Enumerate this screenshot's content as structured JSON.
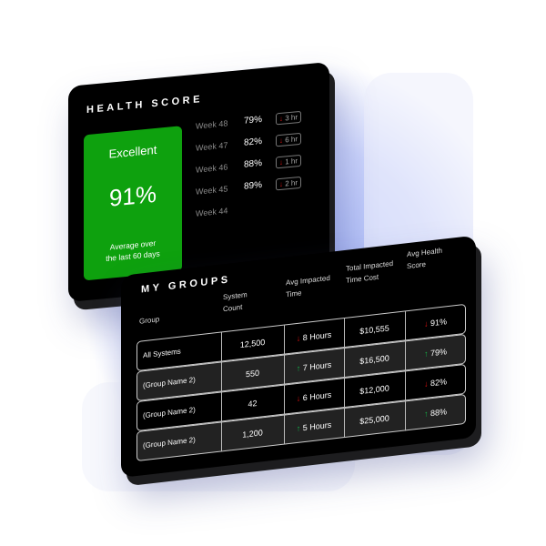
{
  "health": {
    "title": "HEALTH SCORE",
    "rating": "Excellent",
    "score": "91%",
    "caption_line1": "Average over",
    "caption_line2": "the last 60 days",
    "weeks": [
      {
        "label": "Week 48",
        "pct": "79%",
        "change": "3 hr",
        "dir": "down"
      },
      {
        "label": "Week 47",
        "pct": "82%",
        "change": "6 hr",
        "dir": "down"
      },
      {
        "label": "Week 46",
        "pct": "88%",
        "change": "1 hr",
        "dir": "down"
      },
      {
        "label": "Week 45",
        "pct": "89%",
        "change": "2 hr",
        "dir": "down"
      },
      {
        "label": "Week 44"
      }
    ],
    "accent": "#0ea10e"
  },
  "groups": {
    "title": "MY GROUPS",
    "headers": {
      "group": "Group",
      "count_1": "System",
      "count_2": "Count",
      "time_1": "Avg Impacted",
      "time_2": "Time",
      "cost_1": "Total Impacted",
      "cost_2": "Time Cost",
      "score_1": "Avg Health",
      "score_2": "Score"
    },
    "rows": [
      {
        "group": "All Systems",
        "count": "12,500",
        "time": "8 Hours",
        "time_dir": "down",
        "cost": "$10,555",
        "score": "91%",
        "score_dir": "down"
      },
      {
        "group": "(Group Name 2)",
        "count": "550",
        "time": "7 Hours",
        "time_dir": "up",
        "cost": "$16,500",
        "score": "79%",
        "score_dir": "up"
      },
      {
        "group": "(Group Name 2)",
        "count": "42",
        "time": "6 Hours",
        "time_dir": "down",
        "cost": "$12,000",
        "score": "82%",
        "score_dir": "down"
      },
      {
        "group": "(Group Name 2)",
        "count": "1,200",
        "time": "5 Hours",
        "time_dir": "up",
        "cost": "$25,000",
        "score": "88%",
        "score_dir": "up"
      }
    ],
    "colors": {
      "up": "#12b94a",
      "down": "#d11111"
    }
  }
}
